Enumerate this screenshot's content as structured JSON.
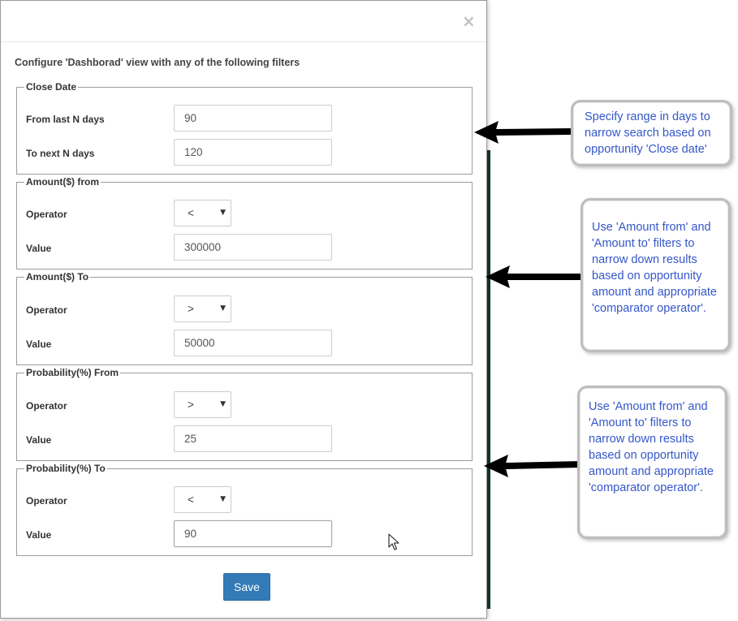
{
  "dialog": {
    "close_glyph": "×",
    "intro": "Configure 'Dashborad' view with any of the following filters",
    "save_label": "Save"
  },
  "sections": {
    "close_date": {
      "legend": "Close Date",
      "from_label": "From last N days",
      "from_value": "90",
      "to_label": "To next N days",
      "to_value": "120"
    },
    "amount_from": {
      "legend": "Amount($) from",
      "operator_label": "Operator",
      "operator_value": "<",
      "value_label": "Value",
      "value": "300000"
    },
    "amount_to": {
      "legend": "Amount($) To",
      "operator_label": "Operator",
      "operator_value": ">",
      "value_label": "Value",
      "value": "50000"
    },
    "probability_from": {
      "legend": "Probability(%) From",
      "operator_label": "Operator",
      "operator_value": ">",
      "value_label": "Value",
      "value": "25"
    },
    "probability_to": {
      "legend": "Probability(%) To",
      "operator_label": "Operator",
      "operator_value": "<",
      "value_label": "Value",
      "value": "90"
    }
  },
  "callouts": {
    "close_date": "Specify range in days to narrow search based on opportunity 'Close date'",
    "amount": "Use 'Amount from' and 'Amount to' filters to narrow down results based on opportunity amount and appropriate 'comparator operator'.",
    "probability": "Use 'Amount from' and 'Amount to' filters to narrow down results based on opportunity amount and appropriate 'comparator operator'."
  },
  "icons": {
    "caret": "chevron-down-icon",
    "close": "close-icon",
    "pointer": "mouse-cursor-icon"
  },
  "colors": {
    "primary_button": "#337ab7",
    "callout_text": "#3557c9",
    "backdrop": "#0f3a2c"
  }
}
